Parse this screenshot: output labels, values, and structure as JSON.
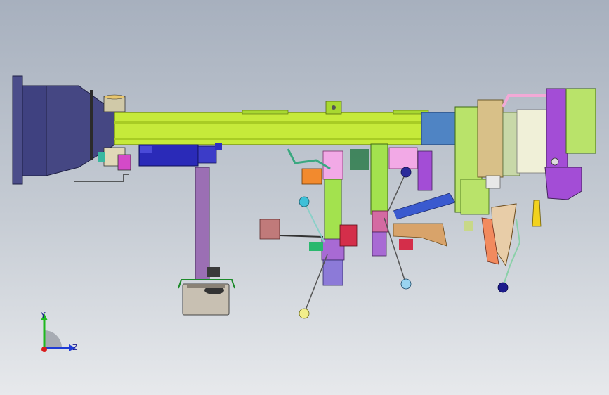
{
  "viewport": {
    "background_top": "#a7b0be",
    "background_bottom": "#e7e9ec",
    "model": {
      "main_beam_color": "#c6ea3a",
      "flange_color": "#4b4d8a",
      "column_color": "#9b6fb4",
      "clamp_purple": "#a34dd6",
      "accent_green": "#b9e36a"
    }
  },
  "triad": {
    "y_label": "Y",
    "z_label": "Z",
    "y_color": "#1fb81f",
    "z_color": "#1f3bd6",
    "origin_color": "#d91c1c"
  }
}
